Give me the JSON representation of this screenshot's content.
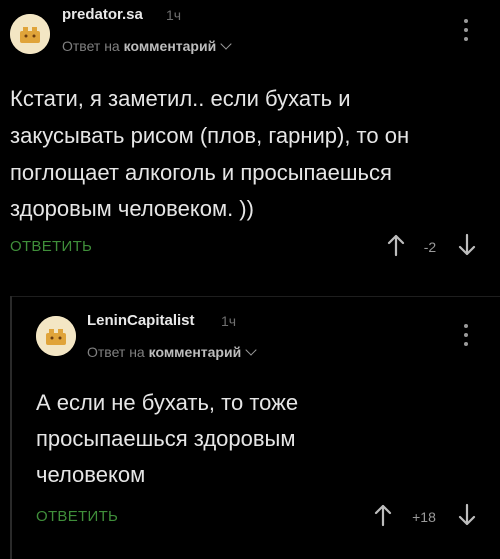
{
  "comments": [
    {
      "username": "predator.sa",
      "time": "1ч",
      "reply_prefix": "Ответ на",
      "reply_target": "комментарий",
      "text_lines": [
        "Кстати, я заметил.. если бухать и",
        "закусывать рисом (плов, гарнир), то он",
        "поглощает алкоголь и просыпаешься",
        "здоровым человеком. ))"
      ],
      "reply_label": "ОТВЕТИТЬ",
      "score": "-2"
    },
    {
      "username": "LeninCapitalist",
      "time": "1ч",
      "reply_prefix": "Ответ на",
      "reply_target": "комментарий",
      "text_lines": [
        "А если не бухать, то тоже",
        "просыпаешься здоровым",
        "человеком"
      ],
      "reply_label": "ОТВЕТИТЬ",
      "score": "+18"
    }
  ],
  "colors": {
    "background": "#000000",
    "reply_accent": "#3f8e3a",
    "avatar_bg": "#f3e6c4"
  },
  "icons": {
    "avatar": "avatar-icon",
    "upvote": "arrow-up-icon",
    "downvote": "arrow-down-icon",
    "more": "more-vertical-icon",
    "expand": "chevron-down-icon"
  }
}
